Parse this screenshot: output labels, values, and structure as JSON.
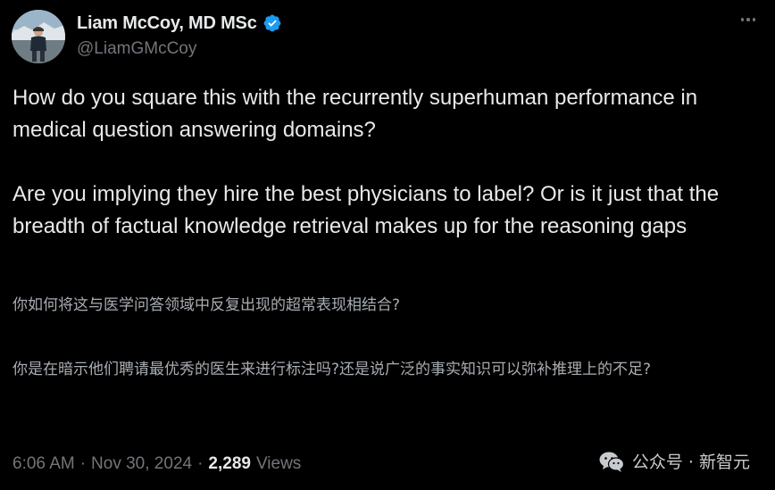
{
  "author": {
    "display_name": "Liam McCoy, MD MSc",
    "handle": "@LiamGMcCoy",
    "verified_icon": "verified-badge-icon",
    "badge_color": "#1d9bf0"
  },
  "tweet": {
    "paragraphs": [
      "How do you square this with the recurrently superhuman performance in medical question answering domains?",
      "Are you implying they hire the best physicians to label? Or is it just that the breadth of factual knowledge retrieval makes up for the reasoning gaps"
    ],
    "translation": [
      "你如何将这与医学问答领域中反复出现的超常表现相结合?",
      "你是在暗示他们聘请最优秀的医生来进行标注吗?还是说广泛的事实知识可以弥补推理上的不足?"
    ]
  },
  "meta": {
    "time": "6:06 AM",
    "date": "Nov 30, 2024",
    "separator": "·",
    "views_count": "2,289",
    "views_label": "Views"
  },
  "watermark": {
    "text": "公众号 · 新智元",
    "icon": "wechat-icon"
  },
  "colors": {
    "background": "#000000",
    "text_primary": "#e7e9ea",
    "text_secondary": "#71767b"
  }
}
